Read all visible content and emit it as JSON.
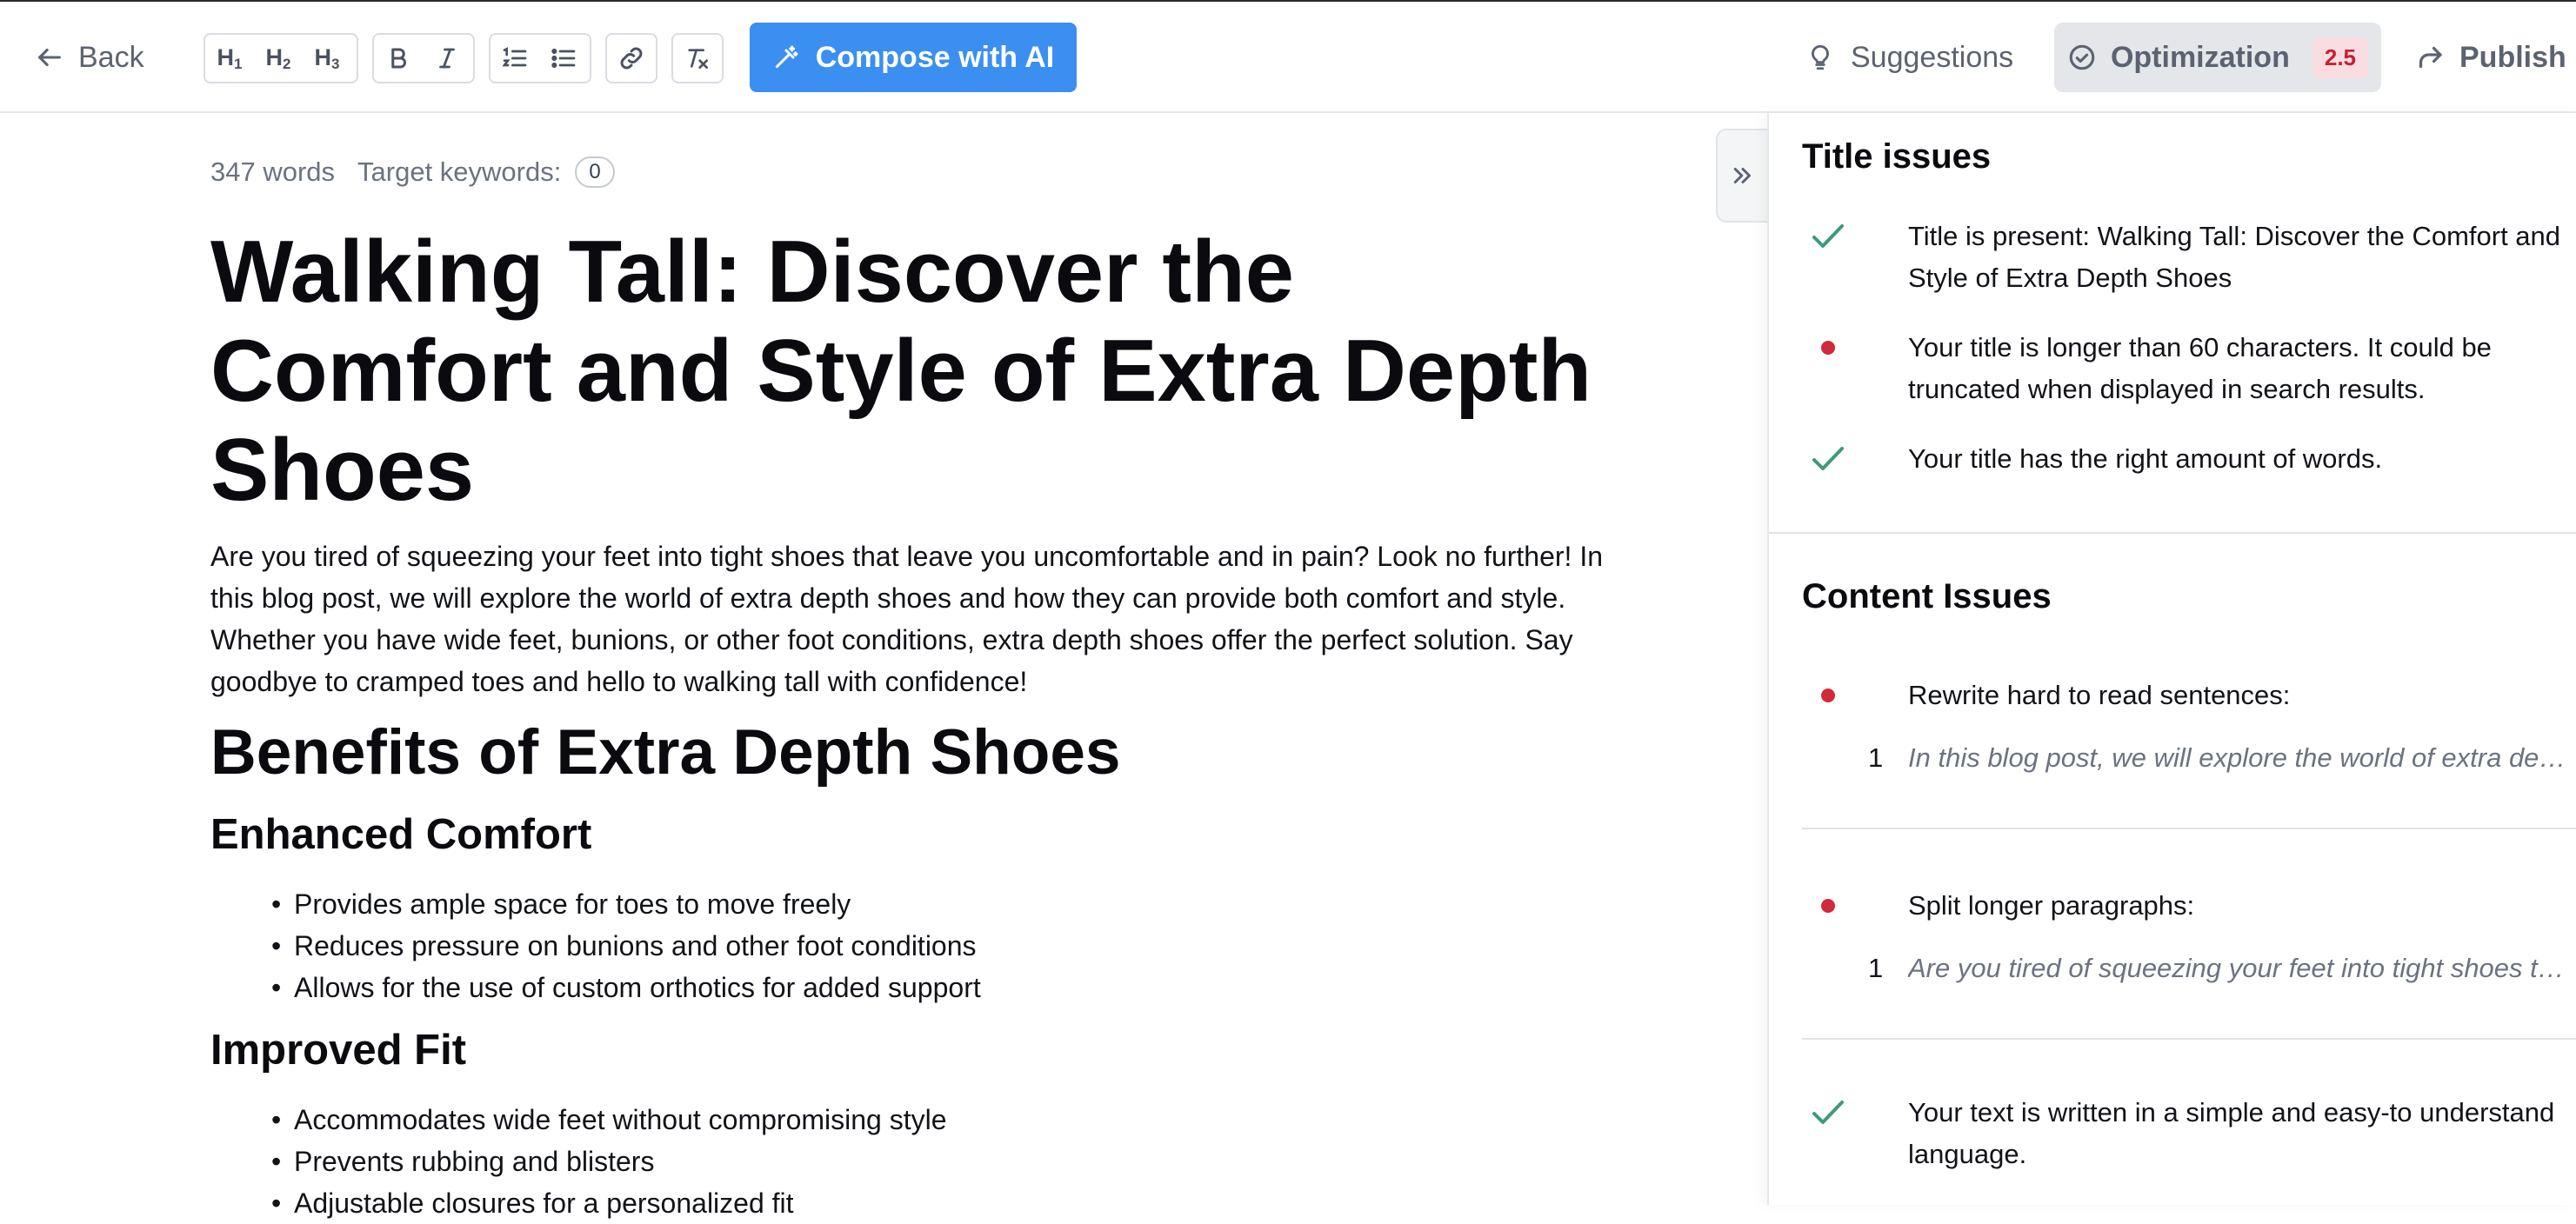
{
  "toolbar": {
    "back_label": "Back",
    "headings": [
      {
        "letter": "H",
        "level": "1"
      },
      {
        "letter": "H",
        "level": "2"
      },
      {
        "letter": "H",
        "level": "3"
      }
    ],
    "compose_label": "Compose with AI",
    "suggestions_label": "Suggestions",
    "optimization_label": "Optimization",
    "optimization_score": "2.5",
    "publish_label": "Publish",
    "accent_color": "#3b8ff0"
  },
  "editor": {
    "word_count": "347 words",
    "target_keywords_label": "Target keywords:",
    "target_keywords_count": "0",
    "title": "Walking Tall: Discover the Comfort and Style of Extra Depth Shoes",
    "intro": "Are you tired of squeezing your feet into tight shoes that leave you uncomfortable and in pain? Look no further! In this blog post, we will explore the world of extra depth shoes and how they can provide both comfort and style. Whether you have wide feet, bunions, or other foot conditions, extra depth shoes offer the perfect solution. Say goodbye to cramped toes and hello to walking tall with confidence!",
    "section_heading": "Benefits of Extra Depth Shoes",
    "subsections": [
      {
        "heading": "Enhanced Comfort",
        "bullets": [
          "Provides ample space for toes to move freely",
          "Reduces pressure on bunions and other foot conditions",
          "Allows for the use of custom orthotics for added support"
        ]
      },
      {
        "heading": "Improved Fit",
        "bullets": [
          "Accommodates wide feet without compromising style",
          "Prevents rubbing and blisters",
          "Adjustable closures for a personalized fit"
        ]
      }
    ]
  },
  "panel": {
    "title_issues_heading": "Title issues",
    "title_issues": [
      {
        "status": "pass",
        "text": "Title is present: Walking Tall: Discover the Comfort and Style of Extra Depth Shoes"
      },
      {
        "status": "fail",
        "text": "Your title is longer than 60 characters. It could be truncated when displayed in search results."
      },
      {
        "status": "pass",
        "text": "Your title has the right amount of words."
      }
    ],
    "content_issues_heading": "Content Issues",
    "content_issues": [
      {
        "status": "fail",
        "text": "Rewrite hard to read sentences:",
        "sample_number": "1",
        "sample": "In this blog post, we will explore the world of extra depth shoes and how they can provide both comfort and style."
      },
      {
        "status": "fail",
        "text": "Split longer paragraphs:",
        "sample_number": "1",
        "sample": "Are you tired of squeezing your feet into tight shoes that leave you uncomfortable and in pain?"
      },
      {
        "status": "pass",
        "text": "Your text is written in a simple and easy-to understand language."
      }
    ],
    "pass_color": "#3e9a78",
    "fail_color": "#d12a3a"
  }
}
